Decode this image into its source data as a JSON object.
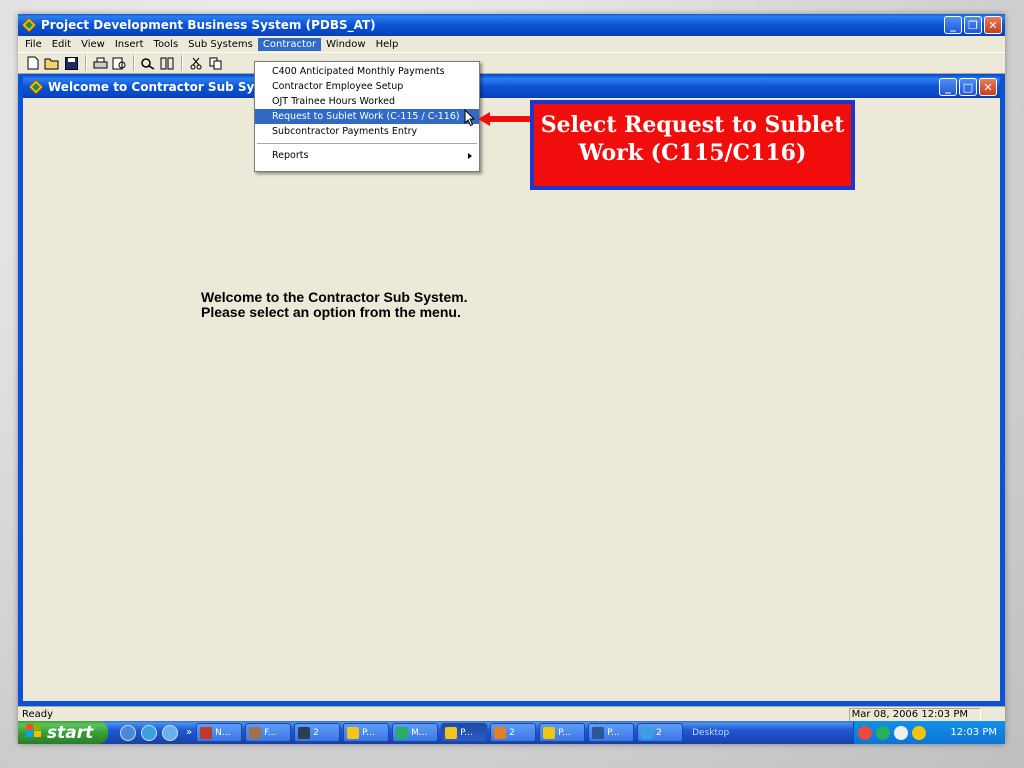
{
  "window": {
    "title": "Project Development Business System (PDBS_AT)"
  },
  "menubar": {
    "items": [
      "File",
      "Edit",
      "View",
      "Insert",
      "Tools",
      "Sub Systems",
      "Contractor",
      "Window",
      "Help"
    ],
    "active": "Contractor"
  },
  "contractor_menu": {
    "items": [
      "C400 Anticipated Monthly Payments",
      "Contractor Employee Setup",
      "OJT Trainee Hours Worked",
      "Request to Sublet Work (C-115 / C-116)",
      "Subcontractor Payments Entry",
      "Reports"
    ],
    "selected": "Request to Sublet Work (C-115 / C-116)"
  },
  "child_window": {
    "title": "Welcome to Contractor Sub System",
    "message_line1": "Welcome to the Contractor Sub System.",
    "message_line2": "Please select an option from the menu."
  },
  "callout": {
    "line1": "Select Request to Sublet",
    "line2": "Work (C115/C116)"
  },
  "statusbar": {
    "status": "Ready",
    "datetime": "Mar 08, 2006 12:03 PM"
  },
  "taskbar": {
    "start_label": "start",
    "tasks": [
      "N...",
      "F...",
      "2",
      "P...",
      "M...",
      "P...",
      "2",
      "P...",
      "P...",
      "2"
    ],
    "desktop_label": "Desktop",
    "clock": "12:03 PM"
  },
  "colors": {
    "xp_blue": "#0b53d4",
    "menu_highlight": "#316ac5",
    "callout_red": "#f20d0d",
    "callout_border": "#1f37c9"
  }
}
